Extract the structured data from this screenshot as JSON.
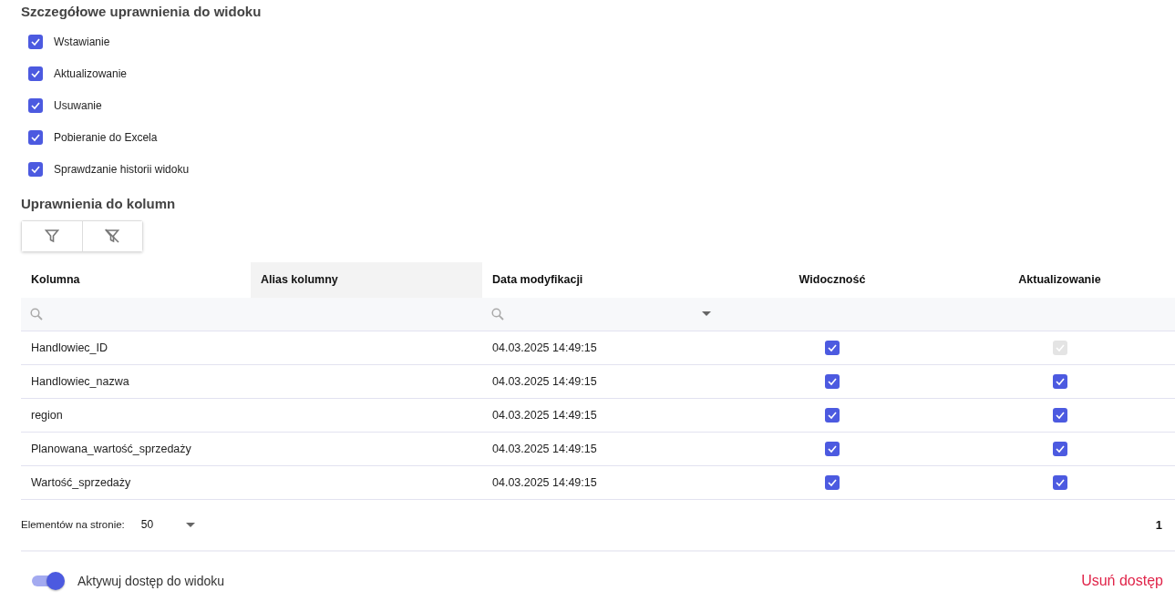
{
  "title": "Szczegółowe uprawnienia do widoku",
  "permissions": [
    {
      "label": "Wstawianie",
      "checked": true
    },
    {
      "label": "Aktualizowanie",
      "checked": true
    },
    {
      "label": "Usuwanie",
      "checked": true
    },
    {
      "label": "Pobieranie do Excela",
      "checked": true
    },
    {
      "label": "Sprawdzanie historii widoku",
      "checked": true
    }
  ],
  "columns_title": "Uprawnienia do kolumn",
  "table": {
    "columns": [
      {
        "label": "Kolumna",
        "kind": "text",
        "highlighted": false,
        "search": true,
        "dropdown": false
      },
      {
        "label": "Alias kolumny",
        "kind": "text",
        "highlighted": true,
        "search": false,
        "dropdown": false
      },
      {
        "label": "Data modyfikacji",
        "kind": "text",
        "highlighted": false,
        "search": true,
        "dropdown": true
      },
      {
        "label": "Widoczność",
        "kind": "check",
        "highlighted": false,
        "search": false,
        "dropdown": false
      },
      {
        "label": "Aktualizowanie",
        "kind": "check",
        "highlighted": false,
        "search": false,
        "dropdown": false
      }
    ],
    "rows": [
      {
        "name": "Handlowiec_ID",
        "modified": "04.03.2025 14:49:15",
        "visible": true,
        "update": true,
        "update_disabled": true
      },
      {
        "name": "Handlowiec_nazwa",
        "modified": "04.03.2025 14:49:15",
        "visible": true,
        "update": true,
        "update_disabled": false
      },
      {
        "name": "region",
        "modified": "04.03.2025 14:49:15",
        "visible": true,
        "update": true,
        "update_disabled": false
      },
      {
        "name": "Planowana_wartość_sprzedaży",
        "modified": "04.03.2025 14:49:15",
        "visible": true,
        "update": true,
        "update_disabled": false
      },
      {
        "name": "Wartość_sprzedaży",
        "modified": "04.03.2025 14:49:15",
        "visible": true,
        "update": true,
        "update_disabled": false
      }
    ]
  },
  "pagination": {
    "label": "Elementów na stronie:",
    "page_size": "50",
    "page": "1"
  },
  "footer": {
    "toggle_label": "Aktywuj dostęp do widoku",
    "toggle_on": true,
    "remove": "Usuń dostęp"
  }
}
